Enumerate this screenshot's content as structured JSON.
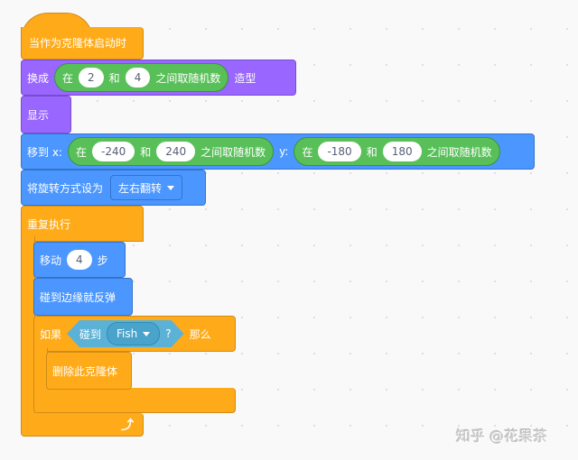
{
  "canvas": {
    "background": "#f9f9f9"
  },
  "colors": {
    "events": "#ffab19",
    "looks": "#9966ff",
    "motion": "#4c97ff",
    "control": "#ffab19",
    "operators": "#59c059",
    "sensing": "#5cb1d6"
  },
  "script": {
    "hat": {
      "label": "当作为克隆体启动时"
    },
    "switch_costume": {
      "prefix": "换成",
      "random": {
        "in": "在",
        "from": "2",
        "and": "和",
        "to": "4",
        "suffix": "之间取随机数"
      },
      "suffix": "造型"
    },
    "show": {
      "label": "显示"
    },
    "goto": {
      "x_label": "移到 x:",
      "x_random": {
        "in": "在",
        "from": "-240",
        "and": "和",
        "to": "240",
        "suffix": "之间取随机数"
      },
      "y_label": "y:",
      "y_random": {
        "in": "在",
        "from": "-180",
        "and": "和",
        "to": "180",
        "suffix": "之间取随机数"
      }
    },
    "rotation_style": {
      "label": "将旋转方式设为",
      "value": "左右翻转"
    },
    "forever": {
      "label": "重复执行",
      "move": {
        "prefix": "移动",
        "steps": "4",
        "suffix": "步"
      },
      "bounce": {
        "label": "碰到边缘就反弹"
      },
      "if": {
        "prefix": "如果",
        "condition": {
          "label": "碰到",
          "target": "Fish",
          "question": "?"
        },
        "suffix": "那么",
        "body": {
          "label": "删除此克隆体"
        }
      },
      "loop_icon": "loop-arrow-icon"
    }
  },
  "watermark": "知乎 @花果茶"
}
